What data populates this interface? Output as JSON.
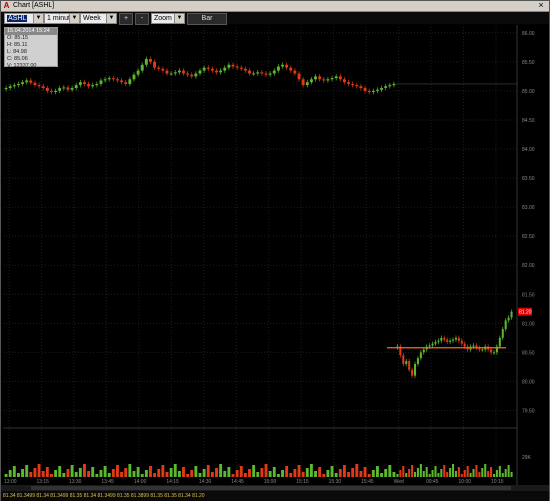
{
  "window": {
    "title": "Chart [ASHL]",
    "close_glyph": "×",
    "icon": "chart-app-icon"
  },
  "toolbar": {
    "symbol": "ASHL",
    "interval": "1 minute",
    "period": "Week",
    "plus_label": "+",
    "minus_label": "-",
    "zoom": "Zoom",
    "bar_label": "Bar"
  },
  "ohlc_box": {
    "header": "15.04.2014 15:24",
    "open": "O: 85.15",
    "high": "H: 85.11",
    "low": "L: 84.98",
    "close": "C: 85.06",
    "volume": "V: 12337.00"
  },
  "current_price_label": "81.20",
  "footer_text": "81.34  81.3499  81.34  81.3499  81.35  81.34  81.3499  81.35  81.3899  81.35  81.35  81.34  81.20",
  "colors": {
    "up": "#5cb82e",
    "down": "#e03b16",
    "grid": "#1e1e1e",
    "axis": "#888888",
    "price_tag": "#dd0000",
    "level": "#ff6a1a"
  },
  "chart_data": {
    "type": "candlestick",
    "y_ticks": [
      "86.00",
      "85.50",
      "85.00",
      "84.50",
      "84.00",
      "83.50",
      "83.00",
      "82.50",
      "82.00",
      "81.50",
      "81.00",
      "80.50",
      "80.00",
      "79.50"
    ],
    "x_ticks": [
      "13:00",
      "13:15",
      "13:30",
      "13:45",
      "14:00",
      "14:15",
      "14:30",
      "14:45",
      "15:00",
      "15:15",
      "15:30",
      "15:45",
      "Wed",
      "09:45",
      "10:00",
      "10:15"
    ],
    "ylim": [
      79.25,
      86.1
    ],
    "volume_axis_label": "29K",
    "session1_close": [
      85.05,
      85.08,
      85.1,
      85.12,
      85.15,
      85.18,
      85.14,
      85.1,
      85.08,
      85.05,
      85.0,
      84.98,
      85.0,
      85.05,
      85.06,
      85.02,
      85.05,
      85.1,
      85.15,
      85.12,
      85.08,
      85.1,
      85.12,
      85.18,
      85.2,
      85.22,
      85.2,
      85.18,
      85.15,
      85.12,
      85.2,
      85.28,
      85.35,
      85.45,
      85.55,
      85.5,
      85.4,
      85.38,
      85.35,
      85.3,
      85.3,
      85.32,
      85.35,
      85.3,
      85.28,
      85.25,
      85.3,
      85.35,
      85.4,
      85.38,
      85.35,
      85.32,
      85.35,
      85.4,
      85.45,
      85.42,
      85.4,
      85.38,
      85.35,
      85.3,
      85.3,
      85.32,
      85.3,
      85.28,
      85.3,
      85.35,
      85.42,
      85.45,
      85.4,
      85.35,
      85.3,
      85.2,
      85.1,
      85.15,
      85.2,
      85.25,
      85.2,
      85.18,
      85.2,
      85.22,
      85.25,
      85.2,
      85.15,
      85.12,
      85.1,
      85.08,
      85.05,
      85.0,
      84.98,
      85.0,
      85.02,
      85.05,
      85.08,
      85.1,
      85.12
    ],
    "session2_close": [
      80.6,
      80.45,
      80.3,
      80.35,
      80.2,
      80.1,
      80.3,
      80.4,
      80.5,
      80.55,
      80.6,
      80.62,
      80.65,
      80.68,
      80.7,
      80.75,
      80.72,
      80.68,
      80.7,
      80.72,
      80.75,
      80.7,
      80.65,
      80.6,
      80.55,
      80.6,
      80.62,
      80.58,
      80.55,
      80.55,
      80.6,
      80.55,
      80.5,
      80.5,
      80.6,
      80.75,
      80.9,
      81.05,
      81.1,
      81.2
    ],
    "level_line": 80.58,
    "current_price": 81.2
  }
}
